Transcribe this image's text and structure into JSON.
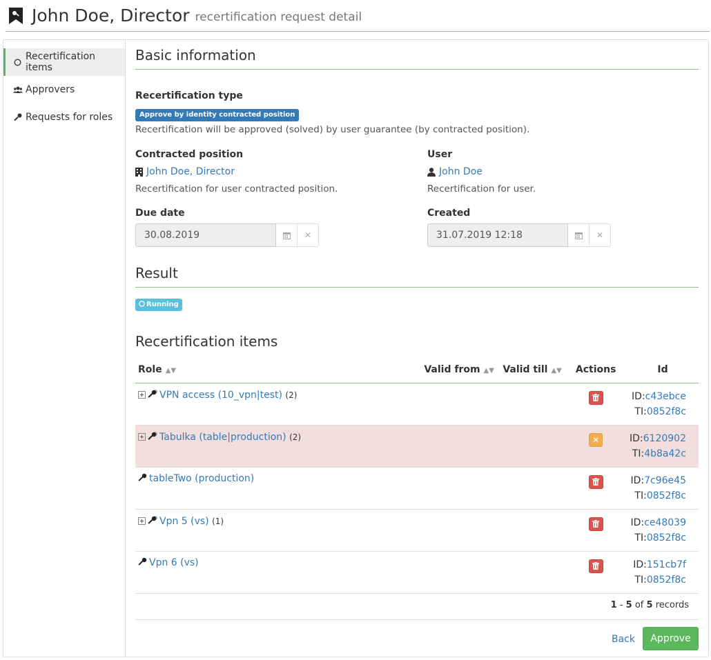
{
  "header": {
    "title": "John Doe, Director",
    "subtitle": "recertification request detail"
  },
  "sidebar": {
    "items": [
      {
        "label": "Recertification items",
        "icon": "circle-icon",
        "active": true
      },
      {
        "label": "Approvers",
        "icon": "users-icon",
        "active": false
      },
      {
        "label": "Requests for roles",
        "icon": "key-icon",
        "active": false
      }
    ]
  },
  "basic": {
    "title": "Basic information",
    "type_label": "Recertification type",
    "type_badge": "Approve by identity contracted position",
    "type_help": "Recertification will be approved (solved) by user guarantee (by contracted position).",
    "position_label": "Contracted position",
    "position_value": "John Doe, Director",
    "position_help": "Recertification for user contracted position.",
    "user_label": "User",
    "user_value": "John Doe",
    "user_help": "Recertification for user.",
    "due_label": "Due date",
    "due_value": "30.08.2019",
    "created_label": "Created",
    "created_value": "31.07.2019 12:18"
  },
  "result": {
    "title": "Result",
    "status": "Running"
  },
  "items": {
    "title": "Recertification items",
    "columns": {
      "role": "Role",
      "valid_from": "Valid from",
      "valid_till": "Valid till",
      "actions": "Actions",
      "id": "Id"
    },
    "rows": [
      {
        "role": "VPN access (10_vpn|test)",
        "count": "(2)",
        "expandable": true,
        "action": "delete",
        "id_prefix": "ID:",
        "id": "c43ebce",
        "ti_prefix": "TI:",
        "ti": "0852f8c",
        "highlight": false
      },
      {
        "role": "Tabulka (table|production)",
        "count": "(2)",
        "expandable": true,
        "action": "cancel",
        "id_prefix": "ID:",
        "id": "6120902",
        "ti_prefix": "TI:",
        "ti": "4b8a42c",
        "highlight": true
      },
      {
        "role": "tableTwo (production)",
        "count": "",
        "expandable": false,
        "action": "delete",
        "id_prefix": "ID:",
        "id": "7c96e45",
        "ti_prefix": "TI:",
        "ti": "0852f8c",
        "highlight": false
      },
      {
        "role": "Vpn 5 (vs)",
        "count": "(1)",
        "expandable": true,
        "action": "delete",
        "id_prefix": "ID:",
        "id": "ce48039",
        "ti_prefix": "TI:",
        "ti": "0852f8c",
        "highlight": false
      },
      {
        "role": "Vpn 6 (vs)",
        "count": "",
        "expandable": false,
        "action": "delete",
        "id_prefix": "ID:",
        "id": "151cb7f",
        "ti_prefix": "TI:",
        "ti": "0852f8c",
        "highlight": false
      }
    ],
    "pagination": {
      "from": "1",
      "dash": " - ",
      "to": "5",
      "of": " of ",
      "total": "5",
      "suffix": " records"
    }
  },
  "footer": {
    "back_label": "Back",
    "approve_label": "Approve"
  },
  "colors": {
    "accent": "#5cb85c",
    "primary": "#337ab7",
    "danger": "#d9534f",
    "warning": "#f0ad4e",
    "info": "#5bc0de",
    "danger_bg": "#f2dede"
  }
}
